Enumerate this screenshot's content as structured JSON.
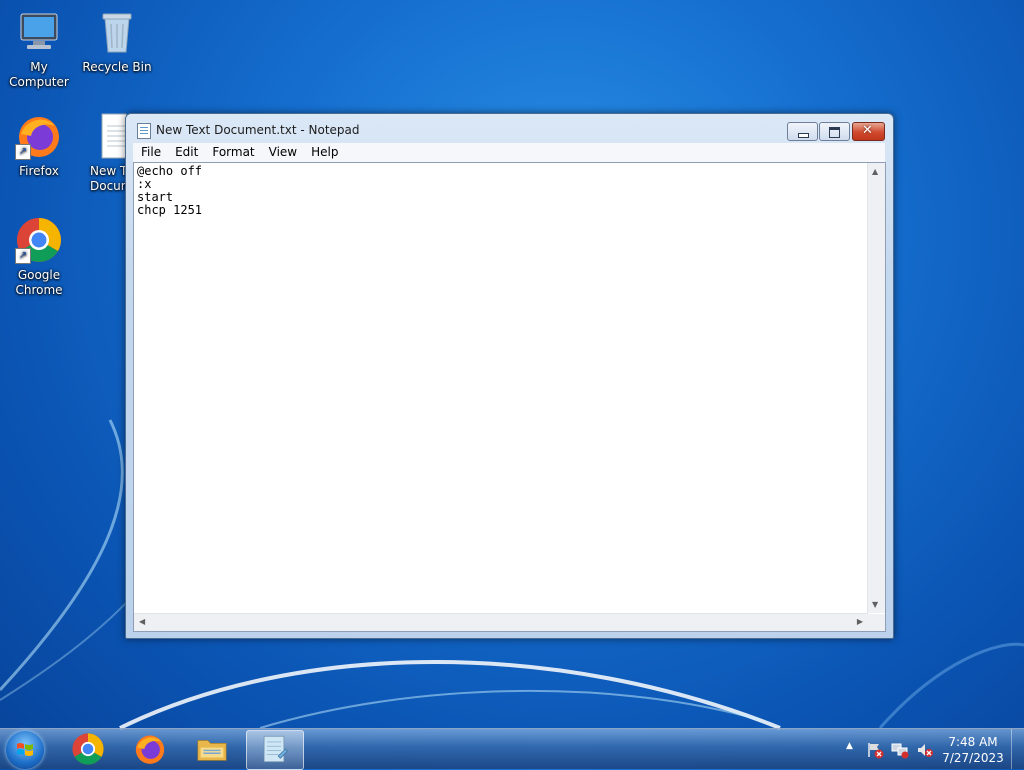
{
  "desktop": {
    "icons": [
      {
        "label": "My Computer"
      },
      {
        "label": "Recycle Bin"
      },
      {
        "label": "Firefox"
      },
      {
        "label": "New Text Document"
      },
      {
        "label": "Google Chrome"
      }
    ]
  },
  "notepad": {
    "title": "New Text Document.txt - Notepad",
    "menu": [
      "File",
      "Edit",
      "Format",
      "View",
      "Help"
    ],
    "content": "@echo off\n:x\nstart\nchcp 1251",
    "controls": {
      "close_glyph": "✕"
    }
  },
  "taskbar": {
    "apps": [
      "Google Chrome",
      "Firefox",
      "Windows Explorer",
      "Notepad"
    ],
    "tray_chevron": "▲",
    "time": "7:48 AM",
    "date": "7/27/2023"
  },
  "colors": {
    "desktop_blue": "#1670d0",
    "close_red": "#cf4a2e",
    "taskbar": "#2a5aa0"
  }
}
